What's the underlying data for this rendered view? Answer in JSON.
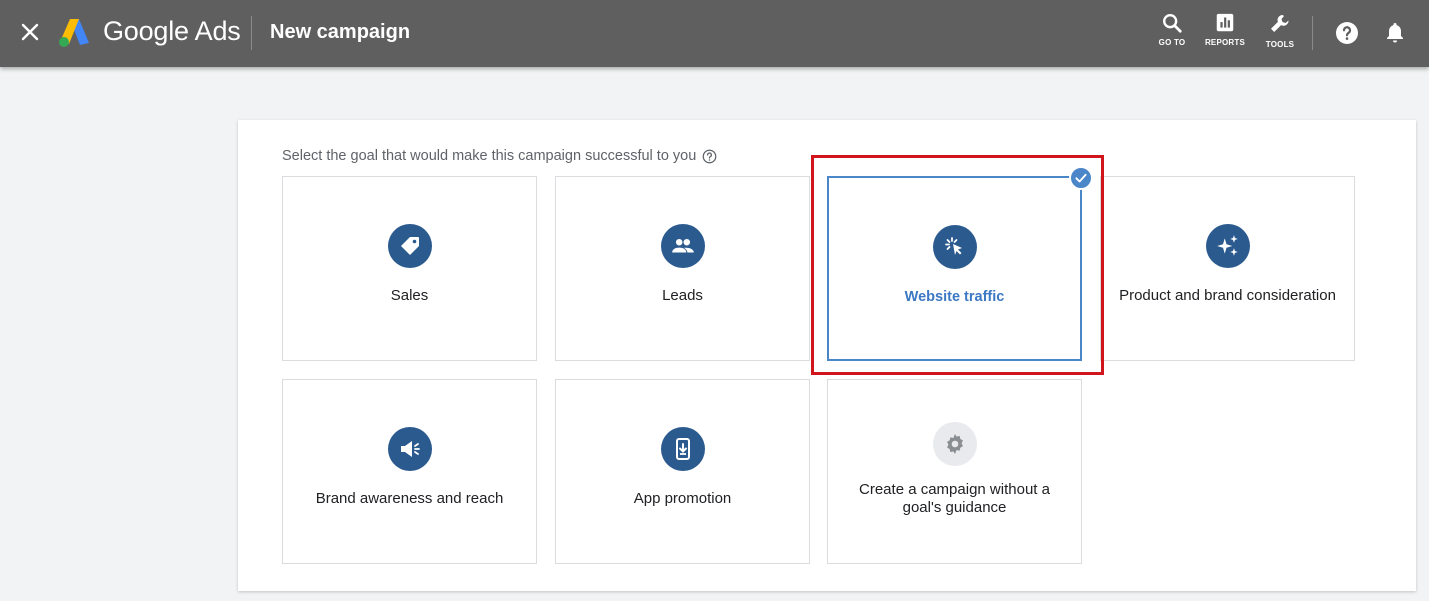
{
  "header": {
    "brand": "Google Ads",
    "title": "New campaign",
    "tools": {
      "goto": "GO TO",
      "reports": "REPORTS",
      "tools": "TOOLS"
    }
  },
  "prompt": "Select the goal that would make this campaign successful to you",
  "goals": [
    {
      "label": "Sales",
      "icon": "tag-icon",
      "selected": false
    },
    {
      "label": "Leads",
      "icon": "people-icon",
      "selected": false
    },
    {
      "label": "Website traffic",
      "icon": "cursor-click-icon",
      "selected": true
    },
    {
      "label": "Product and brand consideration",
      "icon": "sparkle-icon",
      "selected": false
    },
    {
      "label": "Brand awareness and reach",
      "icon": "megaphone-icon",
      "selected": false
    },
    {
      "label": "App promotion",
      "icon": "phone-download-icon",
      "selected": false
    },
    {
      "label": "Create a campaign without a goal's guidance",
      "icon": "gear-icon",
      "selected": false
    }
  ],
  "colors": {
    "topbar": "#5f5f5f",
    "icon_blue": "#2b5a8f",
    "selected_blue": "#4a86c8",
    "highlight_red": "#d0161c"
  }
}
